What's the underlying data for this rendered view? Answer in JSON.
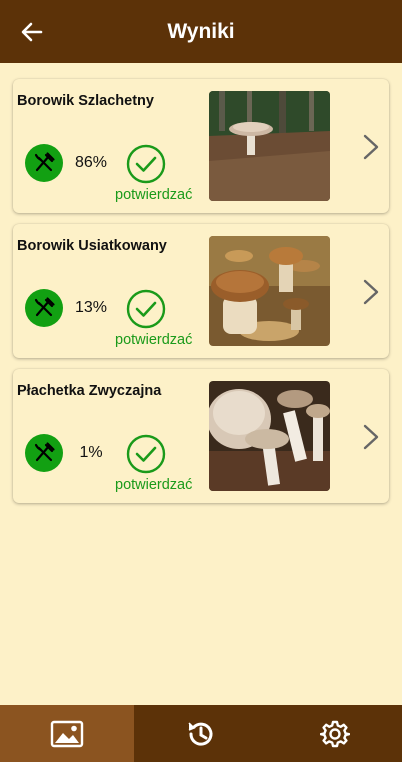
{
  "header": {
    "title": "Wyniki",
    "back_icon": "arrow-left-icon"
  },
  "results": [
    {
      "name": "Borowik Szlachetny",
      "percent": "86%",
      "confirm_label": "potwierdzać",
      "edible_icon": "fork-knife-icon",
      "image": "mushroom-photo"
    },
    {
      "name": "Borowik Usiatkowany",
      "percent": "13%",
      "confirm_label": "potwierdzać",
      "edible_icon": "fork-knife-icon",
      "image": "mushroom-photo"
    },
    {
      "name": "Płachetka Zwyczajna",
      "percent": "1%",
      "confirm_label": "potwierdzać",
      "edible_icon": "fork-knife-icon",
      "image": "mushroom-photo"
    }
  ],
  "bottom_nav": {
    "items": [
      {
        "icon": "image-icon",
        "active": true
      },
      {
        "icon": "history-icon",
        "active": false
      },
      {
        "icon": "settings-gear-icon",
        "active": false
      }
    ]
  },
  "colors": {
    "bar": "#5c3208",
    "bar_active": "#8b5420",
    "background": "#fdf1c8",
    "edible_green": "#12a012",
    "confirm_green": "#1a9a1a"
  }
}
